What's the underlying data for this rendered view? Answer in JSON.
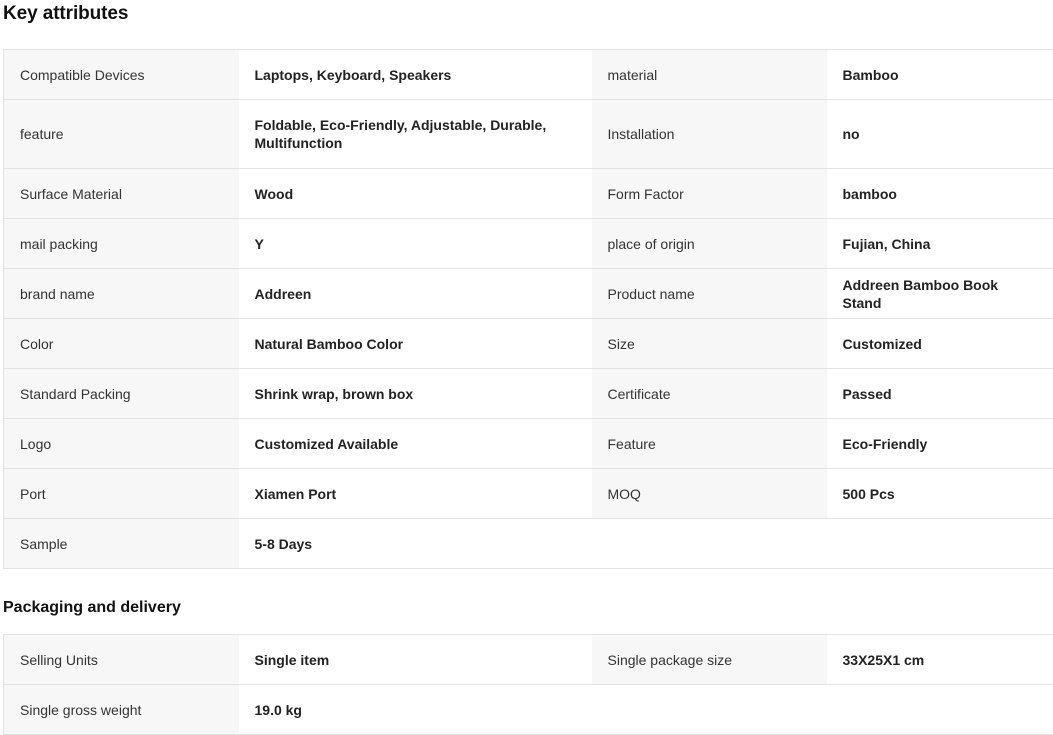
{
  "key_attributes": {
    "title": "Key attributes",
    "rows": [
      [
        {
          "label": "Compatible Devices",
          "value": "Laptops, Keyboard, Speakers"
        },
        {
          "label": "material",
          "value": "Bamboo"
        }
      ],
      [
        {
          "label": "feature",
          "value": "Foldable, Eco-Friendly, Adjustable, Durable, Multifunction"
        },
        {
          "label": "Installation",
          "value": "no"
        }
      ],
      [
        {
          "label": "Surface Material",
          "value": "Wood"
        },
        {
          "label": "Form Factor",
          "value": "bamboo"
        }
      ],
      [
        {
          "label": "mail packing",
          "value": "Y"
        },
        {
          "label": "place of origin",
          "value": "Fujian, China"
        }
      ],
      [
        {
          "label": "brand name",
          "value": "Addreen"
        },
        {
          "label": "Product name",
          "value": "Addreen Bamboo Book Stand"
        }
      ],
      [
        {
          "label": "Color",
          "value": "Natural Bamboo Color"
        },
        {
          "label": "Size",
          "value": "Customized"
        }
      ],
      [
        {
          "label": "Standard Packing",
          "value": "Shrink wrap, brown box"
        },
        {
          "label": "Certificate",
          "value": "Passed"
        }
      ],
      [
        {
          "label": "Logo",
          "value": "Customized Available"
        },
        {
          "label": "Feature",
          "value": "Eco-Friendly"
        }
      ],
      [
        {
          "label": "Port",
          "value": "Xiamen Port"
        },
        {
          "label": "MOQ",
          "value": "500 Pcs"
        }
      ],
      [
        {
          "label": "Sample",
          "value": "5-8 Days"
        }
      ]
    ]
  },
  "packaging": {
    "title": "Packaging and delivery",
    "rows": [
      [
        {
          "label": "Selling Units",
          "value": "Single item"
        },
        {
          "label": "Single package size",
          "value": "33X25X1 cm"
        }
      ],
      [
        {
          "label": "Single gross weight",
          "value": "19.0 kg"
        }
      ]
    ]
  }
}
